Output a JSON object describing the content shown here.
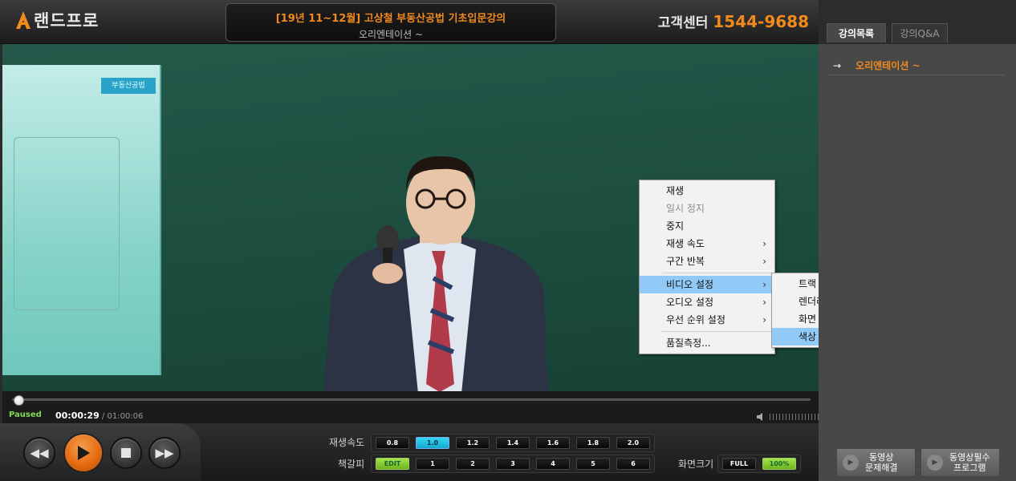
{
  "header": {
    "logo_text": "랜드프로",
    "lecture_title": "[19년 11~12월] 고상철 부동산공법 기초입문강의",
    "lecture_subtitle": "오리엔테이션 ~",
    "cs_label": "고객센터",
    "cs_phone": "1544-9688",
    "accent_color": "#f08a1d"
  },
  "video": {
    "slide_tag": "부동산공법"
  },
  "context_menu": {
    "items": [
      {
        "label": "재생"
      },
      {
        "label": "일시 정지"
      },
      {
        "label": "중지"
      },
      {
        "label": "재생 속도"
      },
      {
        "label": "구간 반복"
      },
      {
        "label": "비디오 설정"
      },
      {
        "label": "오디오 설정"
      },
      {
        "label": "우선 순위 설정"
      },
      {
        "label": "품질측정..."
      }
    ],
    "submenu_arrow": "›",
    "submenu": {
      "items": [
        {
          "label": "트랙"
        },
        {
          "label": "렌더러"
        },
        {
          "label": "화면 비율"
        },
        {
          "label": "색상 조절"
        }
      ]
    }
  },
  "progress": {
    "status": "Paused",
    "current_time": "00:00:29",
    "separator": " / ",
    "duration": "01:00:06",
    "fraction": 0.008
  },
  "controls": {
    "speed_label": "재생속도",
    "speeds": [
      "0.8",
      "1.0",
      "1.2",
      "1.4",
      "1.6",
      "1.8",
      "2.0"
    ],
    "bookmark_label": "책갈피",
    "bookmarks": [
      "EDIT",
      "1",
      "2",
      "3",
      "4",
      "5",
      "6"
    ],
    "screen_label": "화면크기",
    "screen_sizes": [
      "FULL",
      "100%"
    ]
  },
  "panel": {
    "tab_lectures": "강의목록",
    "tab_qa": "강의Q&A",
    "list": [
      {
        "arrow": "→",
        "title": "오리엔테이션 ~"
      }
    ],
    "button1_line1": "동영상",
    "button1_line2": "문제해결",
    "button2_line1": "동영상필수",
    "button2_line2": "프로그램"
  }
}
